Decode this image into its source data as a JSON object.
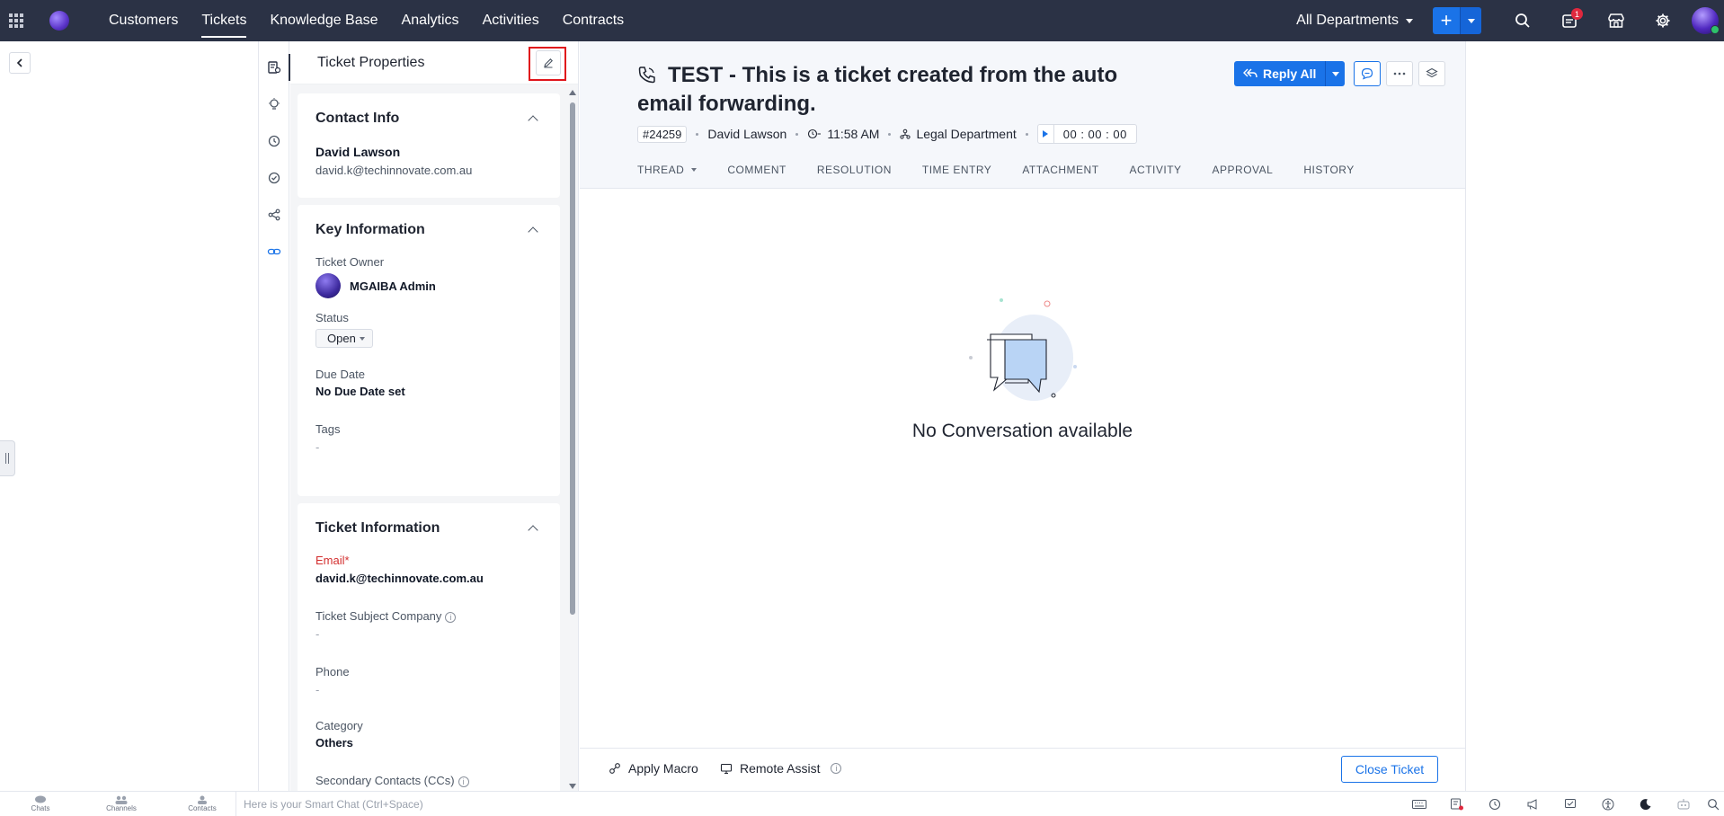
{
  "nav": {
    "items": [
      "Customers",
      "Tickets",
      "Knowledge Base",
      "Analytics",
      "Activities",
      "Contracts"
    ],
    "active": "Tickets",
    "department": "All Departments",
    "notification_count": "1"
  },
  "panel": {
    "title": "Ticket Properties",
    "contact": {
      "heading": "Contact Info",
      "name": "David Lawson",
      "email": "david.k@techinnovate.com.au"
    },
    "key": {
      "heading": "Key Information",
      "owner_label": "Ticket Owner",
      "owner_name": "MGAIBA Admin",
      "status_label": "Status",
      "status_value": "Open",
      "due_label": "Due Date",
      "due_value": "No Due Date set",
      "tags_label": "Tags",
      "tags_value": "-"
    },
    "ticket_info": {
      "heading": "Ticket Information",
      "email_label": "Email",
      "email_required": "*",
      "email_value": "david.k@techinnovate.com.au",
      "company_label": "Ticket Subject Company",
      "company_value": "-",
      "phone_label": "Phone",
      "phone_value": "-",
      "category_label": "Category",
      "category_value": "Others",
      "cc_label": "Secondary Contacts (CCs)"
    }
  },
  "ticket": {
    "title": "TEST - This is a ticket created from the auto email forwarding.",
    "id": "#24259",
    "contact": "David Lawson",
    "time": "11:58 AM",
    "department": "Legal Department",
    "timer": "00 : 00 : 00",
    "reply_label": "Reply All",
    "tabs": [
      "THREAD",
      "COMMENT",
      "RESOLUTION",
      "TIME ENTRY",
      "ATTACHMENT",
      "ACTIVITY",
      "APPROVAL",
      "HISTORY"
    ],
    "empty_text": "No Conversation available",
    "footer": {
      "apply_macro": "Apply Macro",
      "remote_assist": "Remote Assist",
      "close_ticket": "Close Ticket"
    }
  },
  "bottombar": {
    "chats": "Chats",
    "channels": "Channels",
    "contacts": "Contacts",
    "smart_chat_placeholder": "Here is your Smart Chat (Ctrl+Space)"
  },
  "colors": {
    "topbar": "#2b3245",
    "accent": "#1a73e8",
    "highlight": "#e0151b"
  }
}
